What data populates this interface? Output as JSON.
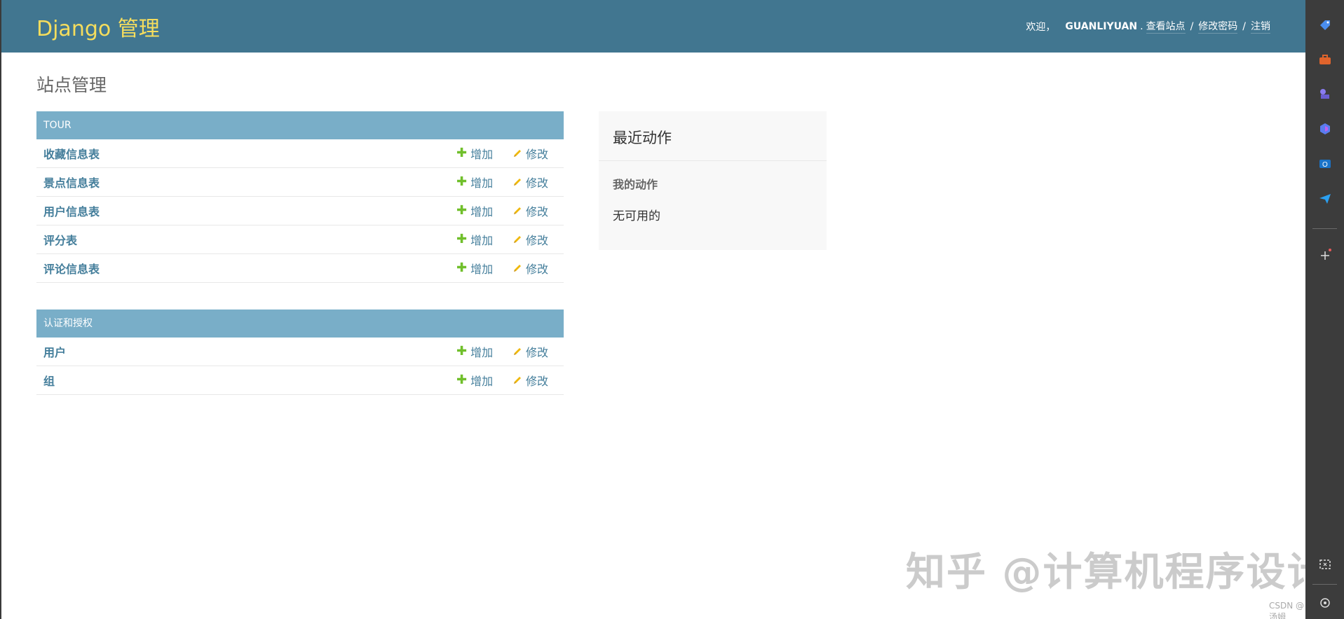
{
  "header": {
    "brand": "Django 管理",
    "welcome": "欢迎，",
    "username": "GUANLIYUAN",
    "punct": ".",
    "links": [
      "查看站点",
      "修改密码",
      "注销"
    ],
    "separator": "/"
  },
  "page": {
    "title": "站点管理"
  },
  "modules": [
    {
      "caption": "TOUR",
      "models": [
        {
          "name": "收藏信息表",
          "add": "增加",
          "change": "修改"
        },
        {
          "name": "景点信息表",
          "add": "增加",
          "change": "修改"
        },
        {
          "name": "用户信息表",
          "add": "增加",
          "change": "修改"
        },
        {
          "name": "评分表",
          "add": "增加",
          "change": "修改"
        },
        {
          "name": "评论信息表",
          "add": "增加",
          "change": "修改"
        }
      ]
    },
    {
      "caption": "认证和授权",
      "models": [
        {
          "name": "用户",
          "add": "增加",
          "change": "修改"
        },
        {
          "name": "组",
          "add": "增加",
          "change": "修改"
        }
      ]
    }
  ],
  "recent_actions": {
    "title": "最近动作",
    "subtitle": "我的动作",
    "empty": "无可用的"
  },
  "sidebar": {
    "icons": [
      "tag-icon",
      "toolbox-icon",
      "games-icon",
      "copilot-icon",
      "outlook-icon",
      "send-icon",
      "plus-icon",
      "screenshot-icon",
      "settings-icon"
    ],
    "colors": {
      "tag": "#4a8ef0",
      "toolbox": "#e0642c",
      "games": "#8a7cf0",
      "copilot": "#5a7cf0",
      "outlook": "#1a73c8",
      "send": "#2a9ff0"
    }
  },
  "watermark": "知乎 @计算机程序设计",
  "footer_mark": "CSDN @汤姆"
}
